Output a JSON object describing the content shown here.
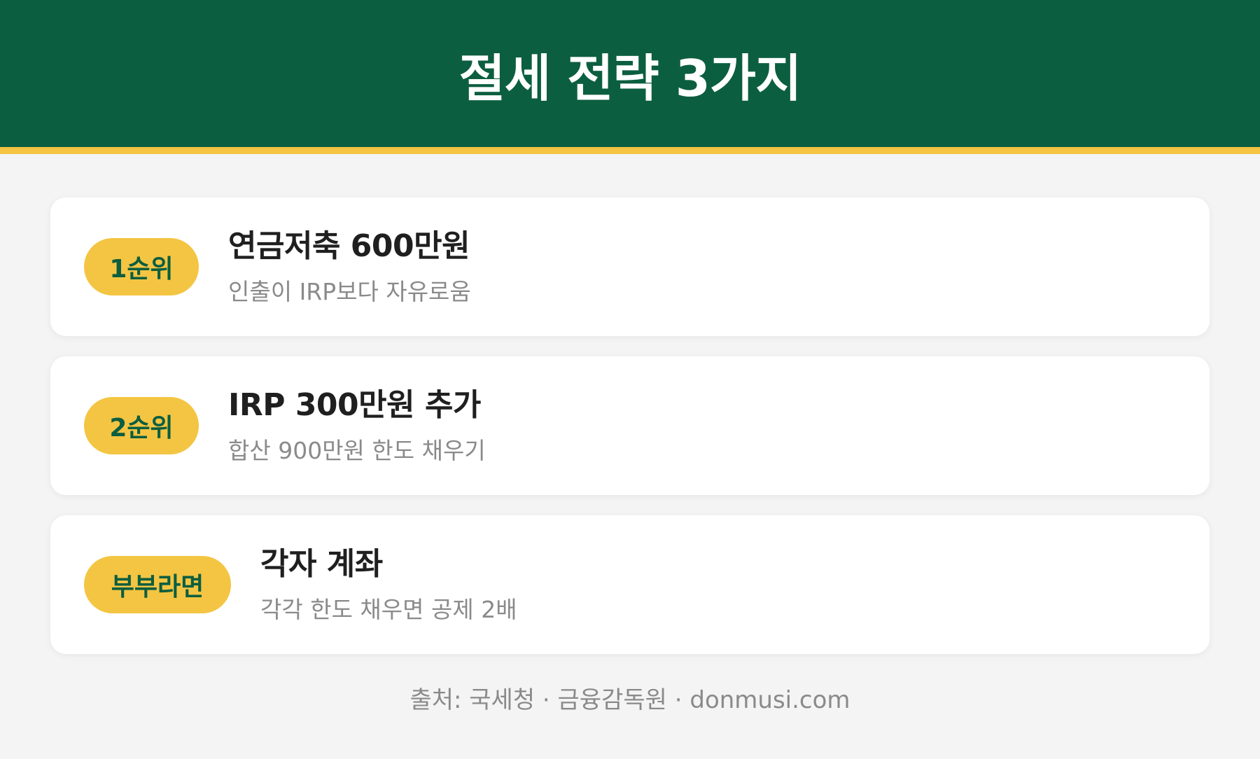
{
  "header": {
    "title": "절세 전략 3가지"
  },
  "cards": [
    {
      "badge": "1순위",
      "title": "연금저축 600만원",
      "description": "인출이 IRP보다 자유로움"
    },
    {
      "badge": "2순위",
      "title": "IRP 300만원 추가",
      "description": "합산 900만원 한도 채우기"
    },
    {
      "badge": "부부라면",
      "title": "각자 계좌",
      "description": "각각 한도 채우면 공제 2배"
    }
  ],
  "footer": {
    "source": "출처: 국세청 · 금융감독원 · donmusi.com"
  },
  "colors": {
    "header_bg": "#0c5e40",
    "accent": "#f4c542",
    "page_bg": "#f3f4f3"
  }
}
